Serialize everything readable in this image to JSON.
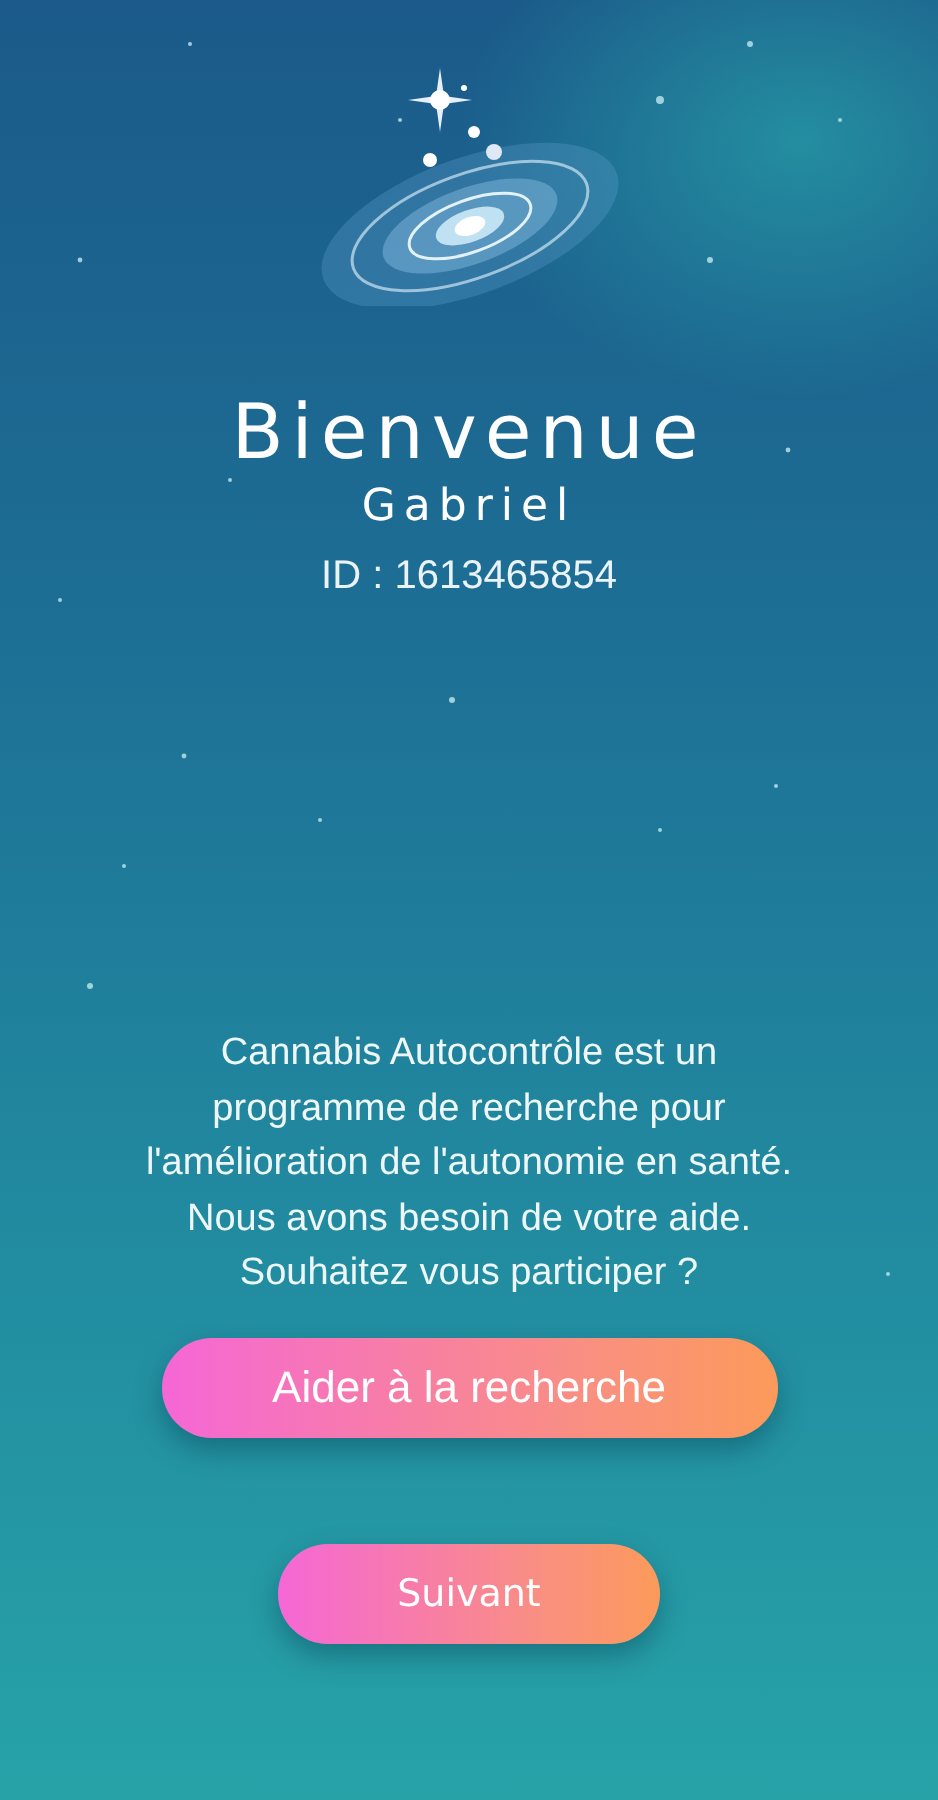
{
  "welcome": {
    "title": "Bienvenue",
    "name": "Gabriel",
    "id_label": "ID : 1613465854"
  },
  "message": "Cannabis Autocontrôle est un programme de recherche pour l'amélioration de l'autonomie en santé. Nous avons besoin de votre aide. Souhaitez vous participer ?",
  "buttons": [
    {
      "label": "Aider à la recherche",
      "kind": "wide"
    },
    {
      "label": "Suivant",
      "kind": "narrow"
    }
  ]
}
